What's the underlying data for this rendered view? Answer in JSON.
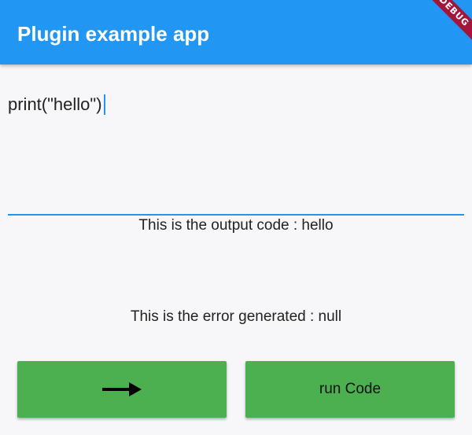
{
  "app_bar": {
    "title": "Plugin example app",
    "background": "#2196f3",
    "debug_banner": "DEBUG"
  },
  "code_input": {
    "value": "print(\"hello\")",
    "accent": "#2196f3"
  },
  "output": {
    "code_line": "This is the output code : hello",
    "error_line": "This is the error generated : null"
  },
  "buttons": {
    "next_icon": "arrow-right-icon",
    "run_label": "run Code",
    "color": "#4caf50"
  }
}
